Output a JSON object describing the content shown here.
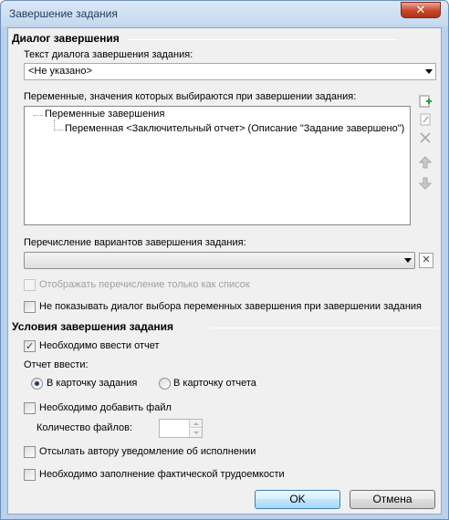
{
  "window": {
    "title": "Завершение задания",
    "close_glyph": "✕"
  },
  "completion_dialog": {
    "section_title": "Диалог завершения",
    "text_label": "Текст диалога завершения задания:",
    "text_value": "<Не указано>",
    "variables_label": "Переменные, значения которых выбираются при завершении задания:",
    "tree": {
      "root": "Переменные завершения",
      "child": "Переменная <Заключительный отчет> (Описание \"Задание завершено\")"
    },
    "side_buttons": [
      "add-icon",
      "edit-icon",
      "delete-icon",
      "arrow-up-icon",
      "arrow-down-icon"
    ],
    "enumeration_label": "Перечисление вариантов завершения задания:",
    "enumeration_value": "",
    "clear_glyph": "✕",
    "list_only_label": "Отображать перечисление только как список",
    "hide_dialog_label": "Не показывать диалог выбора переменных завершения при завершении задания"
  },
  "conditions": {
    "section_title": "Условия завершения задания",
    "report_required_label": "Необходимо ввести отчет",
    "report_required_checked": true,
    "enter_report_label": "Отчет ввести:",
    "radio_task_card": "В карточку задания",
    "radio_report_card": "В карточку отчета",
    "radio_selected": "task_card",
    "file_required_label": "Необходимо добавить файл",
    "file_count_label": "Количество файлов:",
    "file_count_value": "",
    "notify_author_label": "Отсылать автору уведомление об исполнении",
    "labor_required_label": "Необходимо заполнение фактической трудоемкости"
  },
  "buttons": {
    "ok": "OK",
    "cancel": "Отмена"
  }
}
